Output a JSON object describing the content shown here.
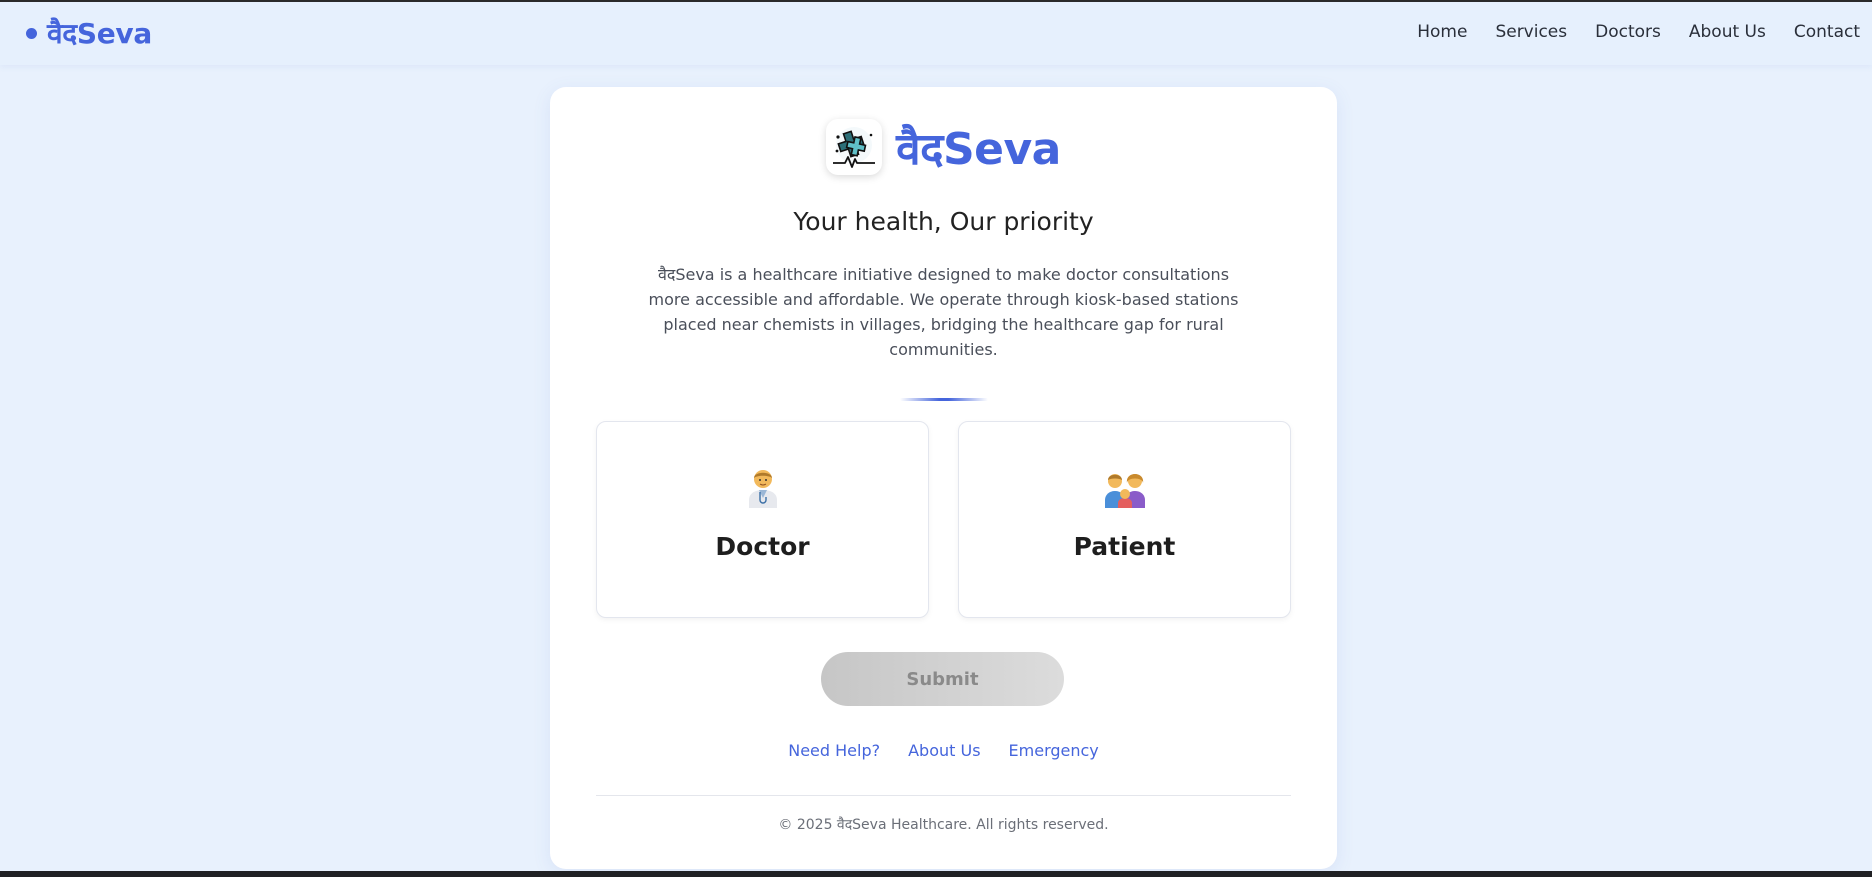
{
  "header": {
    "brand": "वैदSeva",
    "nav": [
      "Home",
      "Services",
      "Doctors",
      "About Us",
      "Contact"
    ]
  },
  "card": {
    "logo_icon": "medical-cross-heartbeat-icon",
    "title": "वैदSeva",
    "tagline": "Your health, Our priority",
    "description": "वैदSeva is a healthcare initiative designed to make doctor consultations more accessible and affordable. We operate through kiosk-based stations placed near chemists in villages, bridging the healthcare gap for rural communities.",
    "roles": [
      {
        "label": "Doctor",
        "icon": "doctor-icon"
      },
      {
        "label": "Patient",
        "icon": "family-icon"
      }
    ],
    "submit_label": "Submit",
    "links": [
      "Need Help?",
      "About Us",
      "Emergency"
    ],
    "copyright": "© 2025 वैदSeva Healthcare. All rights reserved."
  },
  "colors": {
    "accent": "#4565dc",
    "background": "#e8f1fd",
    "submit_disabled": "#d0d0d0"
  }
}
